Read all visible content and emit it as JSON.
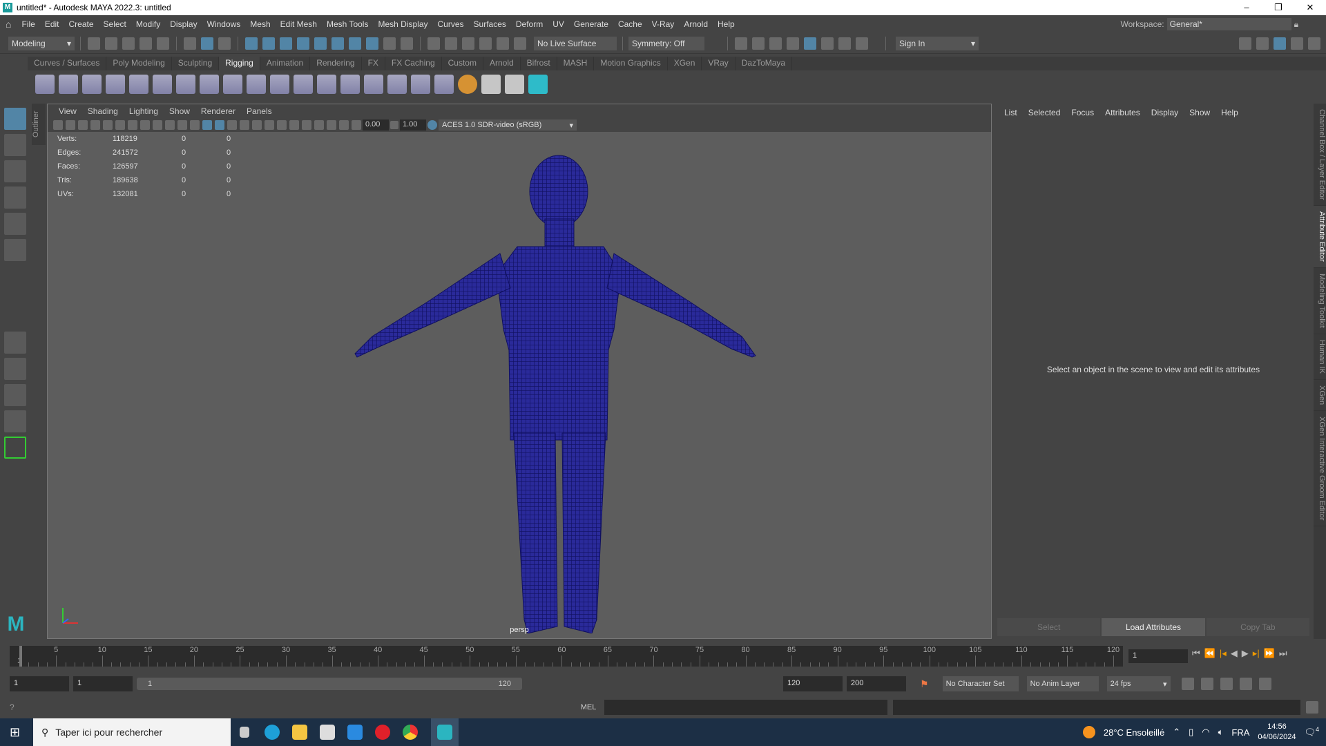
{
  "window": {
    "title": "untitled* - Autodesk MAYA 2022.3: untitled",
    "minimize": "–",
    "restore": "❐",
    "close": "✕"
  },
  "menu": [
    "File",
    "Edit",
    "Create",
    "Select",
    "Modify",
    "Display",
    "Windows",
    "Mesh",
    "Edit Mesh",
    "Mesh Tools",
    "Mesh Display",
    "Curves",
    "Surfaces",
    "Deform",
    "UV",
    "Generate",
    "Cache",
    "V-Ray",
    "Arnold",
    "Help"
  ],
  "workspace": {
    "label": "Workspace:",
    "value": "General*"
  },
  "status": {
    "mode": "Modeling",
    "live_surface": "No Live Surface",
    "symmetry": "Symmetry: Off",
    "sign_in": "Sign In"
  },
  "shelf_tabs": [
    "Curves / Surfaces",
    "Poly Modeling",
    "Sculpting",
    "Rigging",
    "Animation",
    "Rendering",
    "FX",
    "FX Caching",
    "Custom",
    "Arnold",
    "Bifrost",
    "MASH",
    "Motion Graphics",
    "XGen",
    "VRay",
    "DazToMaya"
  ],
  "active_shelf": "Rigging",
  "outliner_tab": "Outliner",
  "viewport": {
    "menu": [
      "View",
      "Shading",
      "Lighting",
      "Show",
      "Renderer",
      "Panels"
    ],
    "exposure": "0.00",
    "gamma": "1.00",
    "color_space": "ACES 1.0 SDR-video (sRGB)",
    "camera": "persp",
    "hud": [
      {
        "label": "Verts:",
        "value": "118219",
        "a": "0",
        "b": "0"
      },
      {
        "label": "Edges:",
        "value": "241572",
        "a": "0",
        "b": "0"
      },
      {
        "label": "Faces:",
        "value": "126597",
        "a": "0",
        "b": "0"
      },
      {
        "label": "Tris:",
        "value": "189638",
        "a": "0",
        "b": "0"
      },
      {
        "label": "UVs:",
        "value": "132081",
        "a": "0",
        "b": "0"
      }
    ]
  },
  "attribute_editor": {
    "menu": [
      "List",
      "Selected",
      "Focus",
      "Attributes",
      "Display",
      "Show",
      "Help"
    ],
    "message": "Select an object in the scene to view and edit its attributes",
    "buttons": [
      "Select",
      "Load Attributes",
      "Copy Tab"
    ]
  },
  "side_tabs": [
    "Channel Box / Layer Editor",
    "Attribute Editor",
    "Modeling Toolkit",
    "Human IK",
    "XGen",
    "XGen Interactive Groom Editor"
  ],
  "timeline": {
    "ticks": [
      5,
      10,
      15,
      20,
      25,
      30,
      35,
      40,
      45,
      50,
      55,
      60,
      65,
      70,
      75,
      80,
      85,
      90,
      95,
      100,
      105,
      110,
      115,
      120
    ],
    "start_label": "1",
    "current_frame": "1"
  },
  "range": {
    "start": "1",
    "playback_start": "1",
    "slider_start": "1",
    "slider_end": "120",
    "playback_end": "120",
    "end": "200",
    "character_set": "No Character Set",
    "anim_layer": "No Anim Layer",
    "fps": "24 fps"
  },
  "command": {
    "lang": "MEL"
  },
  "taskbar": {
    "search_placeholder": "Taper ici pour rechercher",
    "weather": "28°C  Ensoleillé",
    "lang": "FRA",
    "time": "14:56",
    "date": "04/06/2024",
    "notifications": "4"
  },
  "colors": {
    "accent": "#5285a6",
    "mesh": "#1a1a8c",
    "viewport": "#5d5d5d"
  }
}
